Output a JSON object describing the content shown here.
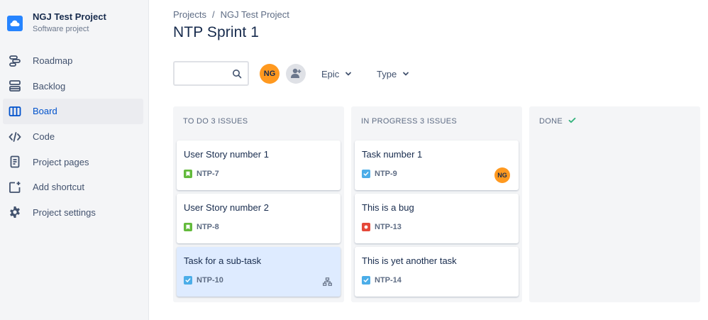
{
  "project": {
    "name": "NGJ Test Project",
    "type": "Software project",
    "logo_icon": "cloud-icon",
    "accent_color": "#2684ff"
  },
  "sidebar": {
    "items": [
      {
        "label": "Roadmap",
        "icon": "roadmap-icon"
      },
      {
        "label": "Backlog",
        "icon": "backlog-icon"
      },
      {
        "label": "Board",
        "icon": "board-icon",
        "active": true
      },
      {
        "label": "Code",
        "icon": "code-icon"
      },
      {
        "label": "Project pages",
        "icon": "page-icon"
      },
      {
        "label": "Add shortcut",
        "icon": "add-shortcut-icon"
      },
      {
        "label": "Project settings",
        "icon": "gear-icon"
      }
    ]
  },
  "breadcrumb": {
    "items": [
      "Projects",
      "NGJ Test Project"
    ],
    "separator": "/"
  },
  "page": {
    "title": "NTP Sprint 1"
  },
  "toolbar": {
    "search_value": "",
    "search_placeholder": "",
    "avatar_initials": "NG",
    "filters": [
      {
        "label": "Epic"
      },
      {
        "label": "Type"
      }
    ]
  },
  "board": {
    "columns": [
      {
        "title": "TO DO 3 ISSUES",
        "cards": [
          {
            "title": "User Story number 1",
            "key": "NTP-7",
            "type": "story"
          },
          {
            "title": "User Story number 2",
            "key": "NTP-8",
            "type": "story"
          },
          {
            "title": "Task for a sub-task",
            "key": "NTP-10",
            "type": "task",
            "selected": true,
            "has_subtasks": true
          }
        ]
      },
      {
        "title": "IN PROGRESS 3 ISSUES",
        "cards": [
          {
            "title": "Task number 1",
            "key": "NTP-9",
            "type": "task",
            "assignee": "NG"
          },
          {
            "title": "This is a bug",
            "key": "NTP-13",
            "type": "bug"
          },
          {
            "title": "This is yet another task",
            "key": "NTP-14",
            "type": "task"
          }
        ]
      },
      {
        "title": "DONE",
        "cards": []
      }
    ]
  },
  "colors": {
    "story": "#63ba3c",
    "task": "#4bade8",
    "bug": "#e5493a",
    "avatar": "#ff991f",
    "selected_card": "#deebff",
    "done_check": "#36b37e"
  }
}
